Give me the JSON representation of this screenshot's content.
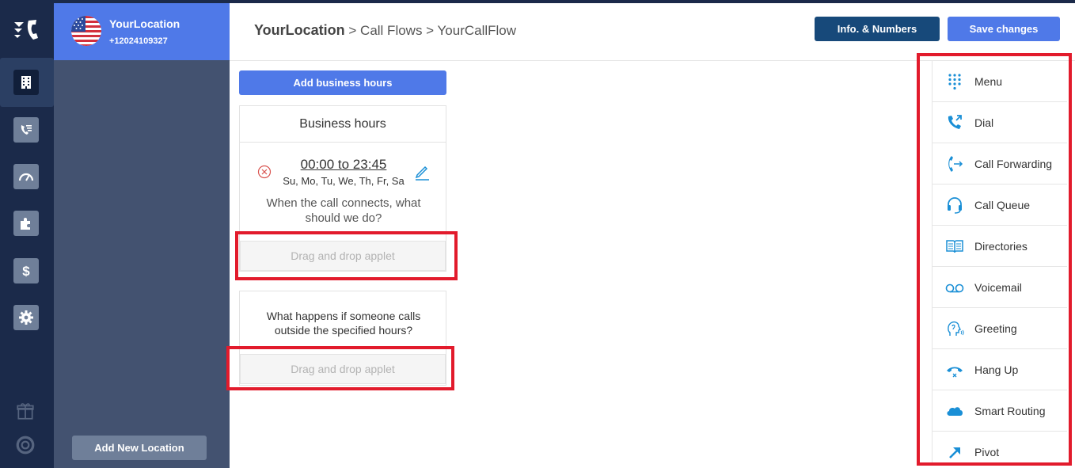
{
  "location": {
    "name": "YourLocation",
    "phone": "+12024109327",
    "add_button": "Add New Location"
  },
  "header": {
    "breadcrumb_root": "YourLocation",
    "breadcrumb_rest": " > Call Flows > YourCallFlow",
    "info_button": "Info. & Numbers",
    "save_button": "Save changes"
  },
  "flow": {
    "add_hours_button": "Add business hours",
    "hours_card_title": "Business hours",
    "time_range": "00:00 to 23:45",
    "days": "Su, Mo, Tu, We, Th, Fr, Sa",
    "connect_question": "When the call connects, what should we do?",
    "drop_placeholder": "Drag and drop applet",
    "outside_question": "What happens if someone calls outside the specified hours?"
  },
  "applets": [
    {
      "label": "Menu",
      "icon": "dialpad-icon"
    },
    {
      "label": "Dial",
      "icon": "phone-outgoing-icon"
    },
    {
      "label": "Call Forwarding",
      "icon": "call-forward-icon"
    },
    {
      "label": "Call Queue",
      "icon": "headset-icon"
    },
    {
      "label": "Directories",
      "icon": "book-icon"
    },
    {
      "label": "Voicemail",
      "icon": "voicemail-icon"
    },
    {
      "label": "Greeting",
      "icon": "speaking-head-icon"
    },
    {
      "label": "Hang Up",
      "icon": "hang-up-icon"
    },
    {
      "label": "Smart Routing",
      "icon": "cloud-icon"
    },
    {
      "label": "Pivot",
      "icon": "arrow-up-right-icon"
    }
  ],
  "colors": {
    "accent": "#4f79e8",
    "navy": "#1b2a4a",
    "dark_button": "#17497a",
    "icon_blue": "#1a8fd6",
    "highlight": "#e21b2c"
  }
}
